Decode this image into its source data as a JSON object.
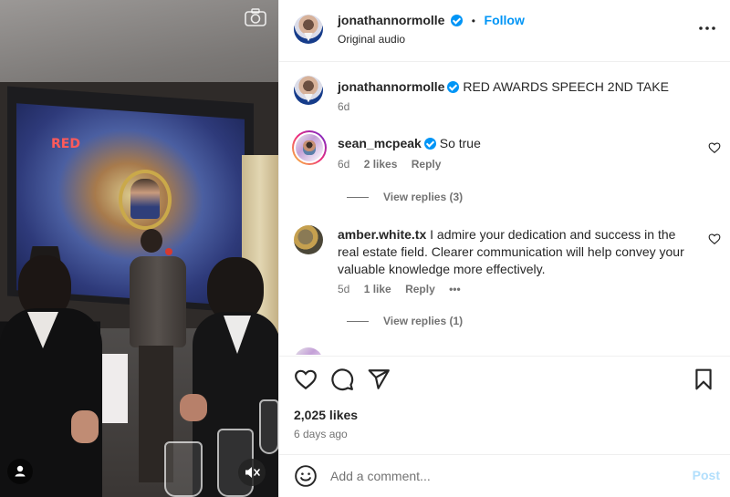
{
  "media": {
    "camera_icon": "camera-icon",
    "user_tag_icon": "user-tag-icon",
    "mute_icon": "volume-off-icon",
    "screen_logo_text": "RED"
  },
  "header": {
    "username": "jonathannormolle",
    "follow_label": "Follow",
    "dot": "•",
    "subtitle": "Original audio",
    "more_label": "•••"
  },
  "caption": {
    "username": "jonathannormolle",
    "text": "RED AWARDS SPEECH 2ND TAKE",
    "time": "6d"
  },
  "comments": [
    {
      "username": "sean_mcpeak",
      "verified": true,
      "text": "So true",
      "time": "6d",
      "likes": "2 likes",
      "reply": "Reply",
      "view_replies": "View replies (3)"
    },
    {
      "username": "amber.white.tx",
      "verified": false,
      "text": "I admire your dedication and success in the real estate field. Clearer communication will help convey your valuable knowledge more effectively.",
      "time": "5d",
      "likes": "1 like",
      "reply": "Reply",
      "more": "•••",
      "view_replies": "View replies (1)"
    }
  ],
  "actions": {
    "likes": "2,025 likes",
    "date": "6 days ago"
  },
  "add_comment": {
    "placeholder": "Add a comment...",
    "post_label": "Post"
  },
  "colors": {
    "link_blue": "#0095f6",
    "post_disabled": "#b2dffc",
    "text_primary": "#262626",
    "text_secondary": "#737373"
  }
}
